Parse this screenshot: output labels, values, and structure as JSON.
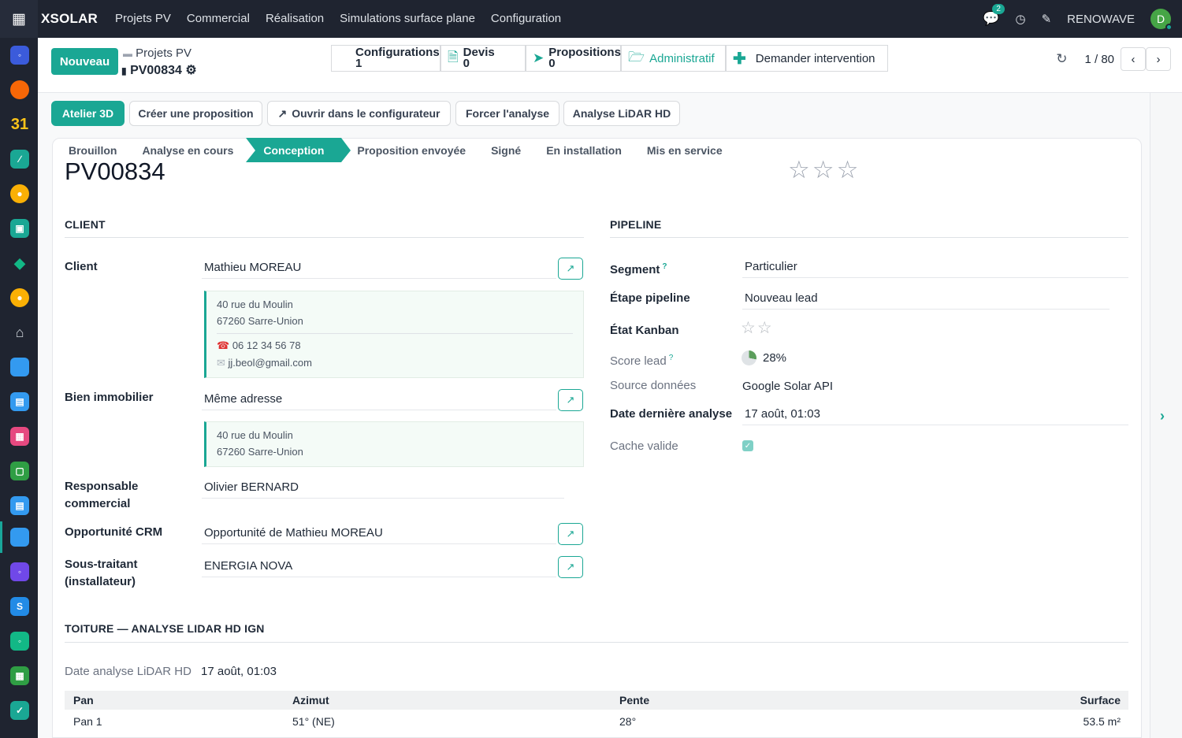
{
  "topbar": {
    "brand": "XSOLAR",
    "menu": [
      "Projets PV",
      "Commercial",
      "Réalisation",
      "Simulations surface plane",
      "Configuration"
    ],
    "chat_count": "2",
    "company": "RENOWAVE",
    "avatar": "D"
  },
  "control": {
    "new_label": "Nouveau",
    "breadcrumb_parent": "Projets PV",
    "record": "PV00834",
    "pager": "1 / 80"
  },
  "smart_buttons": {
    "configurations": {
      "label": "Configurations",
      "count": "1"
    },
    "devis": {
      "label": "Devis",
      "count": "0"
    },
    "propositions": {
      "label": "Propositions",
      "count": "0"
    },
    "administratif": "Administratif",
    "intervention": "Demander intervention"
  },
  "header_buttons": {
    "atelier": "Atelier 3D",
    "creer": "Créer une proposition",
    "ouvrir": "Ouvrir dans le configurateur",
    "forcer": "Forcer l'analyse",
    "lidar": "Analyse LiDAR HD"
  },
  "stages": [
    "Brouillon",
    "Analyse en cours",
    "Conception",
    "Proposition envoyée",
    "Signé",
    "En installation",
    "Mis en service"
  ],
  "active_stage": "Conception",
  "record_title": "PV00834",
  "client_section": {
    "title": "CLIENT",
    "client_label": "Client",
    "client": "Mathieu MOREAU",
    "addr1": "40 rue du Moulin",
    "addr2": "67260 Sarre-Union",
    "phone": "06 12 34 56 78",
    "email": "jj.beol@gmail.com",
    "bien_label": "Bien immobilier",
    "bien": "Même adresse",
    "bien_addr1": "40 rue du Moulin",
    "bien_addr2": "67260 Sarre-Union",
    "resp_label1": "Responsable",
    "resp_label2": "commercial",
    "resp": "Olivier BERNARD",
    "opp_label": "Opportunité CRM",
    "opp": "Opportunité de Mathieu MOREAU",
    "sous_label1": "Sous-traitant",
    "sous_label2": "(installateur)",
    "sous": "ENERGIA NOVA"
  },
  "pipeline_section": {
    "title": "PIPELINE",
    "segment_label": "Segment",
    "segment": "Particulier",
    "etape_label": "Étape pipeline",
    "etape": "Nouveau lead",
    "kanban_label": "État Kanban",
    "score_label": "Score lead",
    "score": "28%",
    "source_label": "Source données",
    "source": "Google Solar API",
    "date_label": "Date dernière analyse",
    "date": "17 août, 01:03",
    "cache_label": "Cache valide",
    "cache_checked": true
  },
  "toiture": {
    "title": "TOITURE — ANALYSE LIDAR HD IGN",
    "date_label": "Date analyse LiDAR HD",
    "date": "17 août, 01:03",
    "columns": [
      "Pan",
      "Azimut",
      "Pente",
      "Surface"
    ],
    "rows": [
      [
        "Pan 1",
        "51° (NE)",
        "28°",
        "53.5 m²"
      ]
    ]
  },
  "colors": {
    "accent": "#1aa794",
    "topbar": "#1f2430"
  }
}
